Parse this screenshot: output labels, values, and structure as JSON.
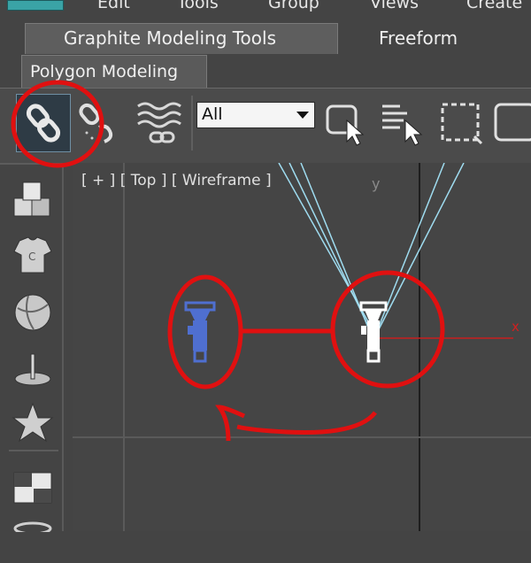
{
  "menubar": {
    "items": [
      "Edit",
      "Tools",
      "Group",
      "Views",
      "Create"
    ]
  },
  "ribbon": {
    "tabs": [
      "Graphite Modeling Tools",
      "Freeform"
    ]
  },
  "panel": {
    "tab": "Polygon Modeling"
  },
  "toolbar": {
    "select_filter": "All",
    "tools": [
      "link-icon",
      "unlink-icon",
      "bind-to-space-warp-icon",
      "select-object-icon",
      "select-by-name-icon",
      "rectangular-selection-icon",
      "window-crossing-icon"
    ]
  },
  "sidebar": {
    "icons": [
      "create-box-icon",
      "cloth-shirt-icon",
      "sphere-ball-icon",
      "pivot-icon",
      "star-shape-icon",
      "display-panel-icon",
      "utilities-icon"
    ]
  },
  "viewport": {
    "label": "[ + ] [ Top ] [ Wireframe ]",
    "axis_y": "y",
    "axis_x": "x"
  },
  "colors": {
    "annotation": "#e01010",
    "selected_object": "#4f6fd0",
    "unselected_object": "#ffffff",
    "camera_lines": "#8fd3e8"
  }
}
